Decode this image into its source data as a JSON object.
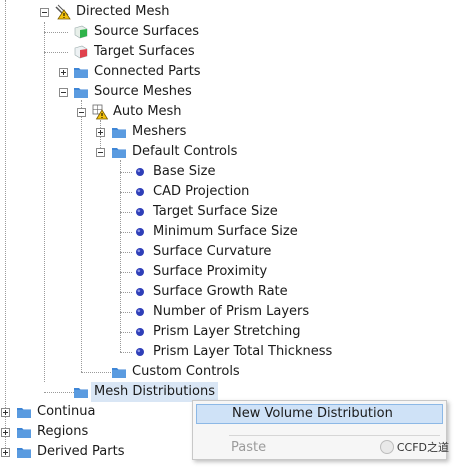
{
  "tree": {
    "directed_mesh": "Directed Mesh",
    "source_surfaces": "Source Surfaces",
    "target_surfaces": "Target Surfaces",
    "connected_parts": "Connected Parts",
    "source_meshes": "Source Meshes",
    "auto_mesh": "Auto Mesh",
    "meshers": "Meshers",
    "default_controls": "Default Controls",
    "controls": [
      "Base Size",
      "CAD Projection",
      "Target Surface Size",
      "Minimum Surface Size",
      "Surface Curvature",
      "Surface Proximity",
      "Surface Growth Rate",
      "Number of Prism Layers",
      "Prism Layer Stretching",
      "Prism Layer Total Thickness"
    ],
    "custom_controls": "Custom Controls",
    "mesh_distributions": "Mesh Distributions",
    "continua": "Continua",
    "regions": "Regions",
    "derived_parts": "Derived Parts"
  },
  "context_menu": {
    "new_volume_distribution": "New Volume Distribution",
    "paste": "Paste"
  },
  "watermark": "CCFD之道",
  "colors": {
    "folder": "#3f86d6",
    "control_dot": "#2f3fb8",
    "selection": "#d9e6f5",
    "menu_highlight": "#cfe2f7"
  }
}
